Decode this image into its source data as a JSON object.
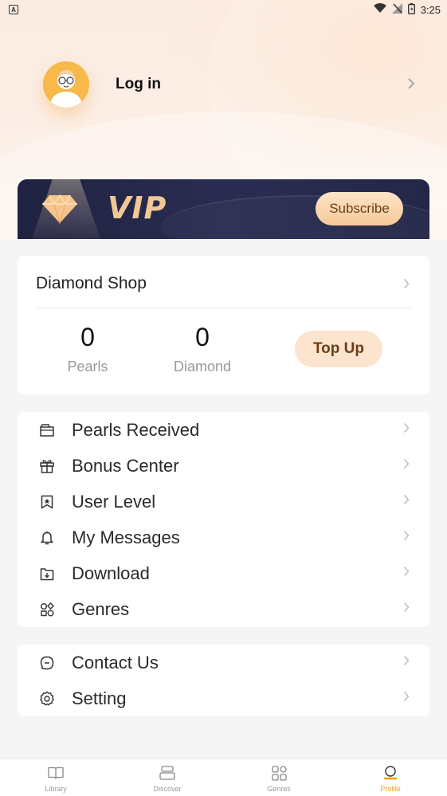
{
  "status_bar": {
    "time": "3:25",
    "app_badge": "A"
  },
  "profile": {
    "login_label": "Log in"
  },
  "vip_banner": {
    "title": "VIP",
    "subscribe_label": "Subscribe"
  },
  "diamond_shop": {
    "title": "Diamond Shop",
    "pearls": {
      "value": "0",
      "label": "Pearls"
    },
    "diamond": {
      "value": "0",
      "label": "Diamond"
    },
    "topup_label": "Top Up"
  },
  "menu_main": [
    {
      "label": "Pearls Received",
      "icon": "wallet-icon"
    },
    {
      "label": "Bonus Center",
      "icon": "gift-icon"
    },
    {
      "label": "User Level",
      "icon": "bookmark-star-icon"
    },
    {
      "label": "My Messages",
      "icon": "bell-icon"
    },
    {
      "label": "Download",
      "icon": "download-folder-icon"
    },
    {
      "label": "Genres",
      "icon": "genres-icon"
    }
  ],
  "menu_secondary": [
    {
      "label": "Contact Us",
      "icon": "chat-icon"
    },
    {
      "label": "Setting",
      "icon": "gear-icon"
    }
  ],
  "bottom_nav": [
    {
      "label": "Library",
      "icon": "book-icon"
    },
    {
      "label": "Discover",
      "icon": "discover-icon"
    },
    {
      "label": "Genres",
      "icon": "grid-icon"
    },
    {
      "label": "Profile",
      "icon": "profile-icon",
      "active": true
    }
  ],
  "colors": {
    "accent": "#f0a020",
    "vip_bg": "#242748",
    "vip_gold": "#f1c895",
    "topup_bg": "#fce4cf"
  }
}
